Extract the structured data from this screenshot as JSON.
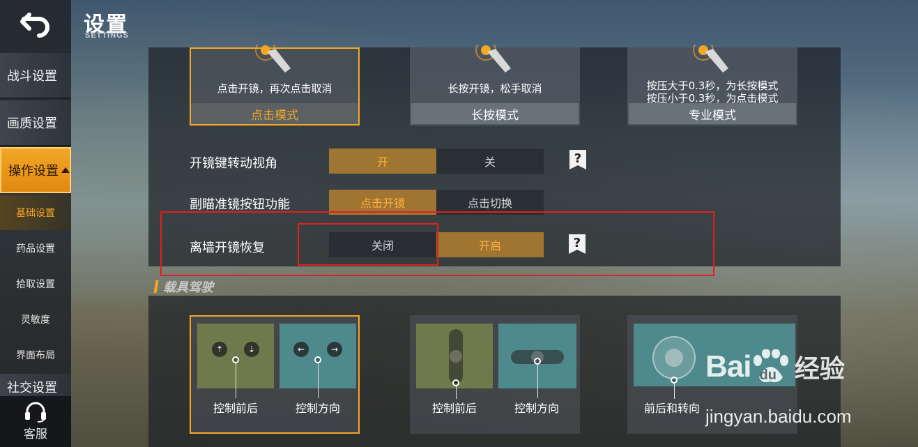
{
  "header": {
    "title": "设置",
    "subtitle": "SETTINGS"
  },
  "sidebar": {
    "main_items": [
      {
        "label": "战斗设置"
      },
      {
        "label": "画质设置"
      },
      {
        "label": "操作设置"
      },
      {
        "label": "社交设置"
      }
    ],
    "sub_items": [
      {
        "label": "基础设置"
      },
      {
        "label": "药品设置"
      },
      {
        "label": "拾取设置"
      },
      {
        "label": "灵敏度"
      },
      {
        "label": "界面布局"
      }
    ],
    "support_label": "客服"
  },
  "scope_modes": [
    {
      "desc_lines": [
        "点击开镜，再次点击取消"
      ],
      "label": "点击模式",
      "selected": true
    },
    {
      "desc_lines": [
        "长按开镜，松手取消"
      ],
      "label": "长按模式",
      "selected": false
    },
    {
      "desc_lines": [
        "按压大于0.3秒，为长按模式",
        "按压小于0.3秒，为点击模式"
      ],
      "label": "专业模式",
      "selected": false
    }
  ],
  "settings_rows": [
    {
      "label": "开镜键转动视角",
      "options": [
        "开",
        "关"
      ],
      "selected": 0,
      "help": "?"
    },
    {
      "label": "副瞄准镜按钮功能",
      "options": [
        "点击开镜",
        "点击切换"
      ],
      "selected": 0
    },
    {
      "label": "离墙开镜恢复",
      "options": [
        "关闭",
        "开启"
      ],
      "selected": 1,
      "help": "?"
    }
  ],
  "vehicle_section": {
    "title": "载具驾驶",
    "cards": [
      {
        "labels": [
          "控制前后",
          "控制方向"
        ],
        "selected": true
      },
      {
        "labels": [
          "控制前后",
          "控制方向"
        ],
        "selected": false
      },
      {
        "labels": [
          "前后和转向"
        ],
        "selected": false
      }
    ]
  },
  "watermark": {
    "logo_bai": "Bai",
    "logo_du": "du",
    "logo_jingyan": "经验",
    "url": "jingyan.baidu.com"
  },
  "colors": {
    "accent": "#f5a623",
    "highlight": "#e02020",
    "toggle_on": "#a07431"
  }
}
